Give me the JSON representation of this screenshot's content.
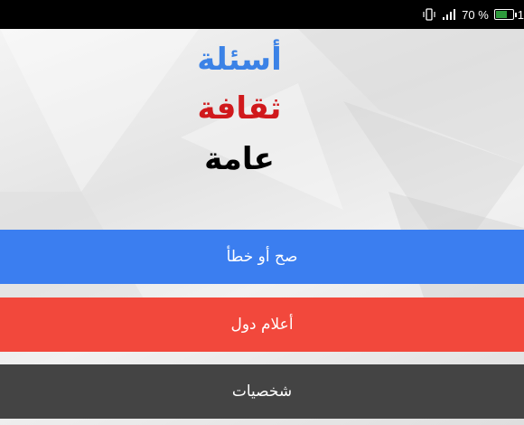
{
  "status_bar": {
    "battery_text": "70 %",
    "trailing": "1",
    "icons": [
      "vibrate-icon",
      "signal-icon",
      "battery-icon"
    ],
    "battery_level": 0.7
  },
  "title": {
    "line1": "أسئلة",
    "line2": "ثقافة",
    "line3": "عامة",
    "colors": {
      "line1": "#3b82e6",
      "line2": "#d0191c",
      "line3": "#000000"
    }
  },
  "menu": {
    "items": [
      {
        "label": "صح أو خطأ",
        "color": "#3b7ef0"
      },
      {
        "label": "أعلام دول",
        "color": "#f2483c"
      },
      {
        "label": "شخصيات",
        "color": "#444444"
      }
    ]
  }
}
